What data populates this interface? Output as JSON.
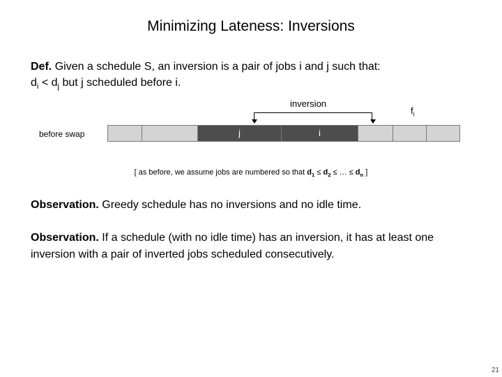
{
  "title": "Minimizing Lateness: Inversions",
  "def": {
    "label": "Def.",
    "line1_a": "Given a schedule S, an ",
    "inversion_word": "inversion",
    "line1_b": " is a pair of jobs i and j such that:",
    "line2_a": "d",
    "line2_sub_i": "i",
    "line2_b": " < d",
    "line2_sub_j": "j",
    "line2_c": " but j scheduled before i."
  },
  "diagram": {
    "inversion_label": "inversion",
    "fi_label_f": "f",
    "fi_label_sub": "i",
    "before_swap": "before swap",
    "job_j": "j",
    "job_i": "i"
  },
  "note": {
    "a": "[ as before, we assume jobs are numbered so that ",
    "d1": "d",
    "s1": "1",
    "leq1": " ≤ ",
    "d2": "d",
    "s2": "2",
    "leq2": " ≤ … ≤ ",
    "dn": "d",
    "sn": "n",
    "b": " ]"
  },
  "obs1": {
    "label": "Observation.",
    "text": "  Greedy schedule has no inversions and no idle time."
  },
  "obs2": {
    "label": "Observation.",
    "text": "  If a schedule (with no idle time) has an inversion, it has at least one inversion with a pair of inverted jobs scheduled consecutively."
  },
  "page_number": "21"
}
